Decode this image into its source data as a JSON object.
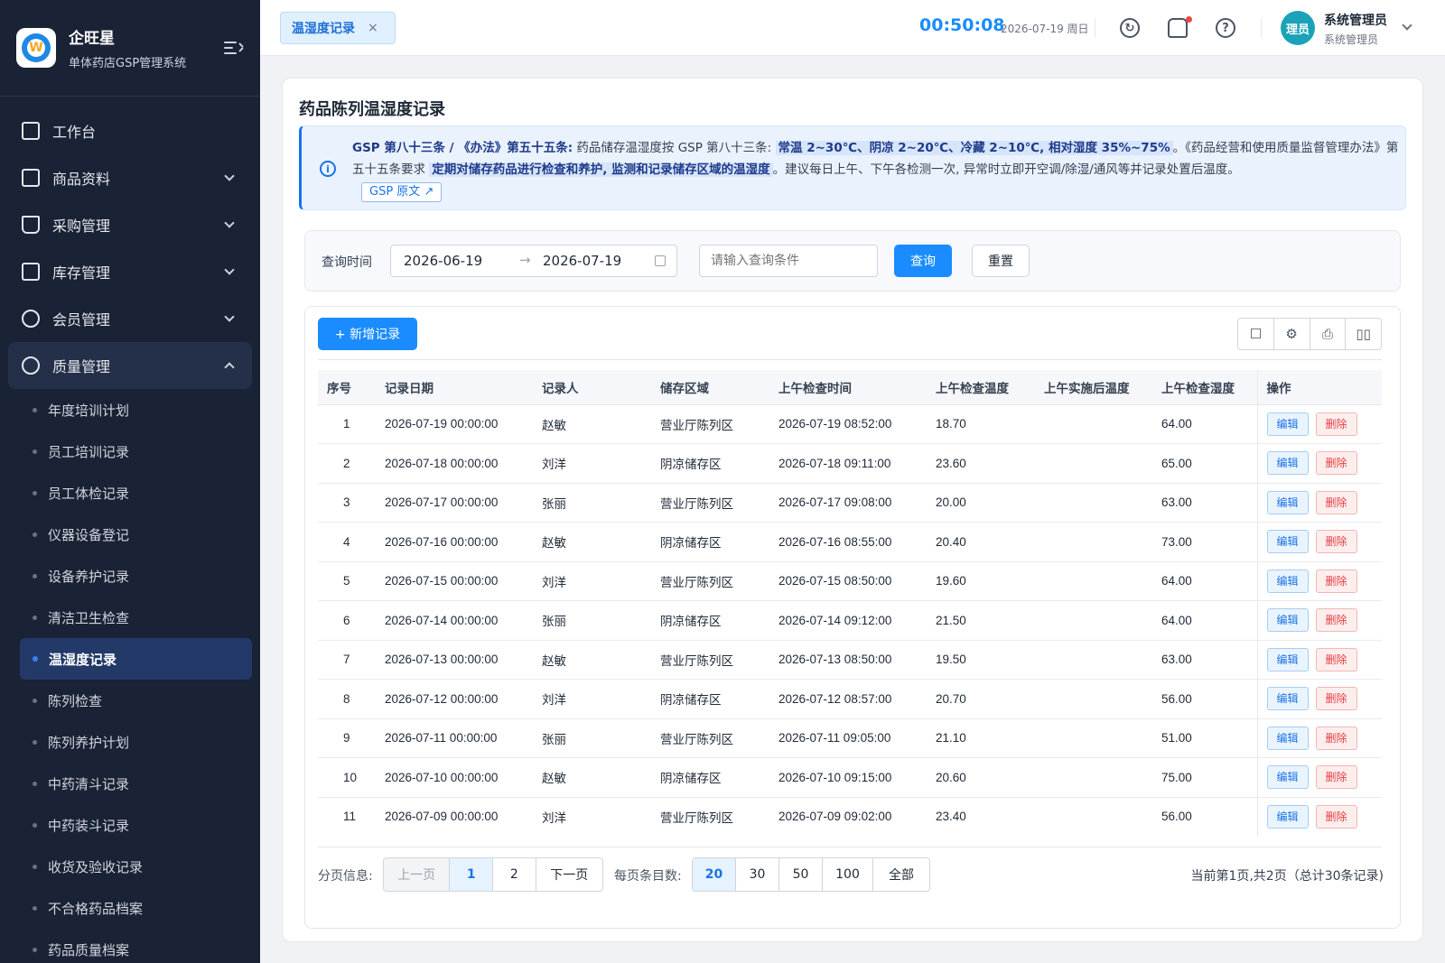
{
  "brand": {
    "name": "企旺星",
    "subtitle": "单体药店GSP管理系统"
  },
  "menu": [
    {
      "label": "工作台",
      "icon": "dashboard-icon"
    },
    {
      "label": "商品资料",
      "icon": "goods-icon"
    },
    {
      "label": "采购管理",
      "icon": "cart-icon"
    },
    {
      "label": "库存管理",
      "icon": "inventory-icon"
    },
    {
      "label": "会员管理",
      "icon": "members-icon"
    },
    {
      "label": "质量管理",
      "icon": "quality-icon"
    }
  ],
  "quality_sub": [
    "年度培训计划",
    "员工培训记录",
    "员工体检记录",
    "仪器设备登记",
    "设备养护记录",
    "清洁卫生检查",
    "温湿度记录",
    "陈列检查",
    "陈列养护计划",
    "中药清斗记录",
    "中药装斗记录",
    "收货及验收记录",
    "不合格药品档案",
    "药品质量档案"
  ],
  "topbar": {
    "tab": "温湿度记录",
    "tab_close": "×",
    "clock": "00:50:08",
    "date": "2026-07-19 周日",
    "avatar_text": "理员",
    "user_name": "系统管理员",
    "user_role": "系统管理员"
  },
  "page": {
    "title": "药品陈列温湿度记录",
    "notice": {
      "lead": "GSP 第八十三条 / 《办法》第五十五条:",
      "t1": " 药品储存温湿度按 GSP 第八十三条: ",
      "h1": "常温 2~30℃、阴凉 2~20℃、冷藏 2~10℃, 相对湿度 35%~75%",
      "t2": "。《药品经营和使用质量监督管理办法》第五十五条要求 ",
      "h2": "定期对储存药品进行检查和养护, 监测和记录储存区域的温湿度",
      "t3": "。建议每日上午、下午各检测一次, 异常时立即开空调/除湿/通风等并记录处置后温度。",
      "link": "GSP 原文"
    },
    "filter": {
      "label": "查询时间",
      "start": "2026-06-19",
      "end": "2026-07-19",
      "arrow": "→",
      "placeholder": "请输入查询条件",
      "query": "查询",
      "reset": "重置"
    },
    "add_button": "+ 新增记录",
    "table": {
      "headers": [
        "序号",
        "记录日期",
        "记录人",
        "储存区域",
        "上午检查时间",
        "上午检查温度",
        "上午实施后温度",
        "上午检查湿度",
        "操作"
      ],
      "edit": "编辑",
      "delete": "删除",
      "rows": [
        [
          "1",
          "2026-07-19 00:00:00",
          "赵敏",
          "营业厅陈列区",
          "2026-07-19 08:52:00",
          "18.70",
          "",
          "64.00"
        ],
        [
          "2",
          "2026-07-18 00:00:00",
          "刘洋",
          "阴凉储存区",
          "2026-07-18 09:11:00",
          "23.60",
          "",
          "65.00"
        ],
        [
          "3",
          "2026-07-17 00:00:00",
          "张丽",
          "营业厅陈列区",
          "2026-07-17 09:08:00",
          "20.00",
          "",
          "63.00"
        ],
        [
          "4",
          "2026-07-16 00:00:00",
          "赵敏",
          "阴凉储存区",
          "2026-07-16 08:55:00",
          "20.40",
          "",
          "73.00"
        ],
        [
          "5",
          "2026-07-15 00:00:00",
          "刘洋",
          "营业厅陈列区",
          "2026-07-15 08:50:00",
          "19.60",
          "",
          "64.00"
        ],
        [
          "6",
          "2026-07-14 00:00:00",
          "张丽",
          "阴凉储存区",
          "2026-07-14 09:12:00",
          "21.50",
          "",
          "64.00"
        ],
        [
          "7",
          "2026-07-13 00:00:00",
          "赵敏",
          "营业厅陈列区",
          "2026-07-13 08:50:00",
          "19.50",
          "",
          "63.00"
        ],
        [
          "8",
          "2026-07-12 00:00:00",
          "刘洋",
          "阴凉储存区",
          "2026-07-12 08:57:00",
          "20.70",
          "",
          "56.00"
        ],
        [
          "9",
          "2026-07-11 00:00:00",
          "张丽",
          "营业厅陈列区",
          "2026-07-11 09:05:00",
          "21.10",
          "",
          "51.00"
        ],
        [
          "10",
          "2026-07-10 00:00:00",
          "赵敏",
          "阴凉储存区",
          "2026-07-10 09:15:00",
          "20.60",
          "",
          "75.00"
        ],
        [
          "11",
          "2026-07-09 00:00:00",
          "刘洋",
          "营业厅陈列区",
          "2026-07-09 09:02:00",
          "23.40",
          "",
          "56.00"
        ]
      ]
    },
    "pager": {
      "label": "分页信息:",
      "prev": "上一页",
      "pages": [
        "1",
        "2"
      ],
      "next": "下一页",
      "size_label": "每页条目数:",
      "sizes": [
        "20",
        "30",
        "50",
        "100",
        "全部"
      ],
      "info": "当前第1页,共2页（总计30条记录)"
    }
  },
  "colors": {
    "primary": "#1a8cff",
    "sidebar": "#1a2236",
    "danger": "#e53e3e"
  }
}
